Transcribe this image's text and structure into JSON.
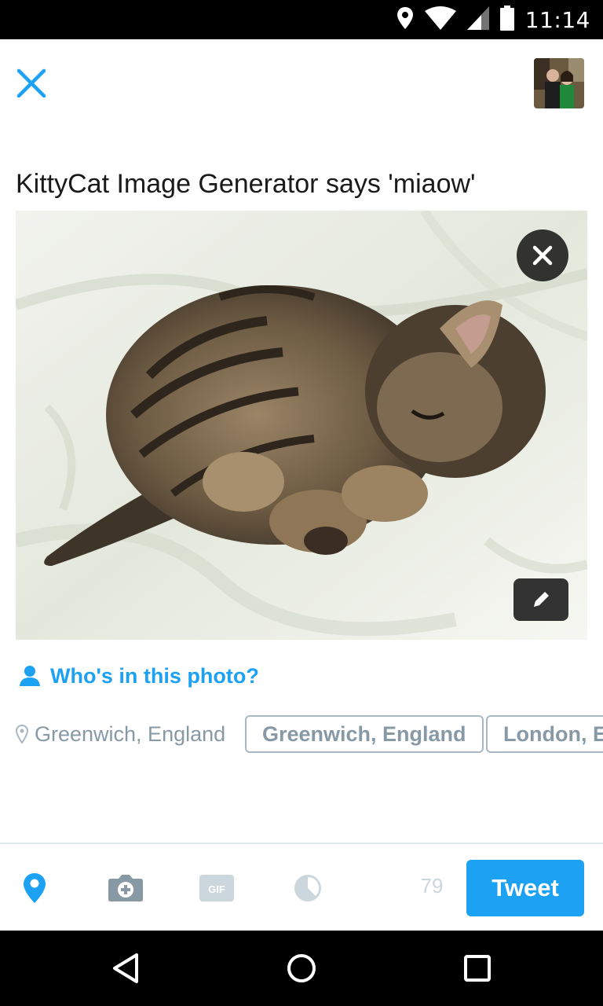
{
  "status_bar": {
    "time": "11:14",
    "icons": [
      "location-icon",
      "wifi-icon",
      "signal-icon",
      "battery-icon"
    ]
  },
  "header": {
    "close_icon": "close-icon",
    "avatar": "user-avatar"
  },
  "compose": {
    "text": "KittyCat Image Generator says 'miaow'"
  },
  "photo": {
    "subject": "kitten-photo",
    "remove_icon": "close-icon",
    "edit_icon": "pencil-icon"
  },
  "tag_people": {
    "label": "Who's in this photo?",
    "icon": "person-icon"
  },
  "location": {
    "current_label": "Greenwich, England",
    "suggestions": [
      "Greenwich, England",
      "London, En"
    ]
  },
  "toolbar": {
    "char_count": "79",
    "tweet_label": "Tweet",
    "icons": [
      "location-pin-icon",
      "camera-icon",
      "gif-icon",
      "poll-icon"
    ]
  },
  "colors": {
    "accent": "#1da1f2",
    "muted": "#8899a6",
    "disabled": "#ccd6dd"
  }
}
